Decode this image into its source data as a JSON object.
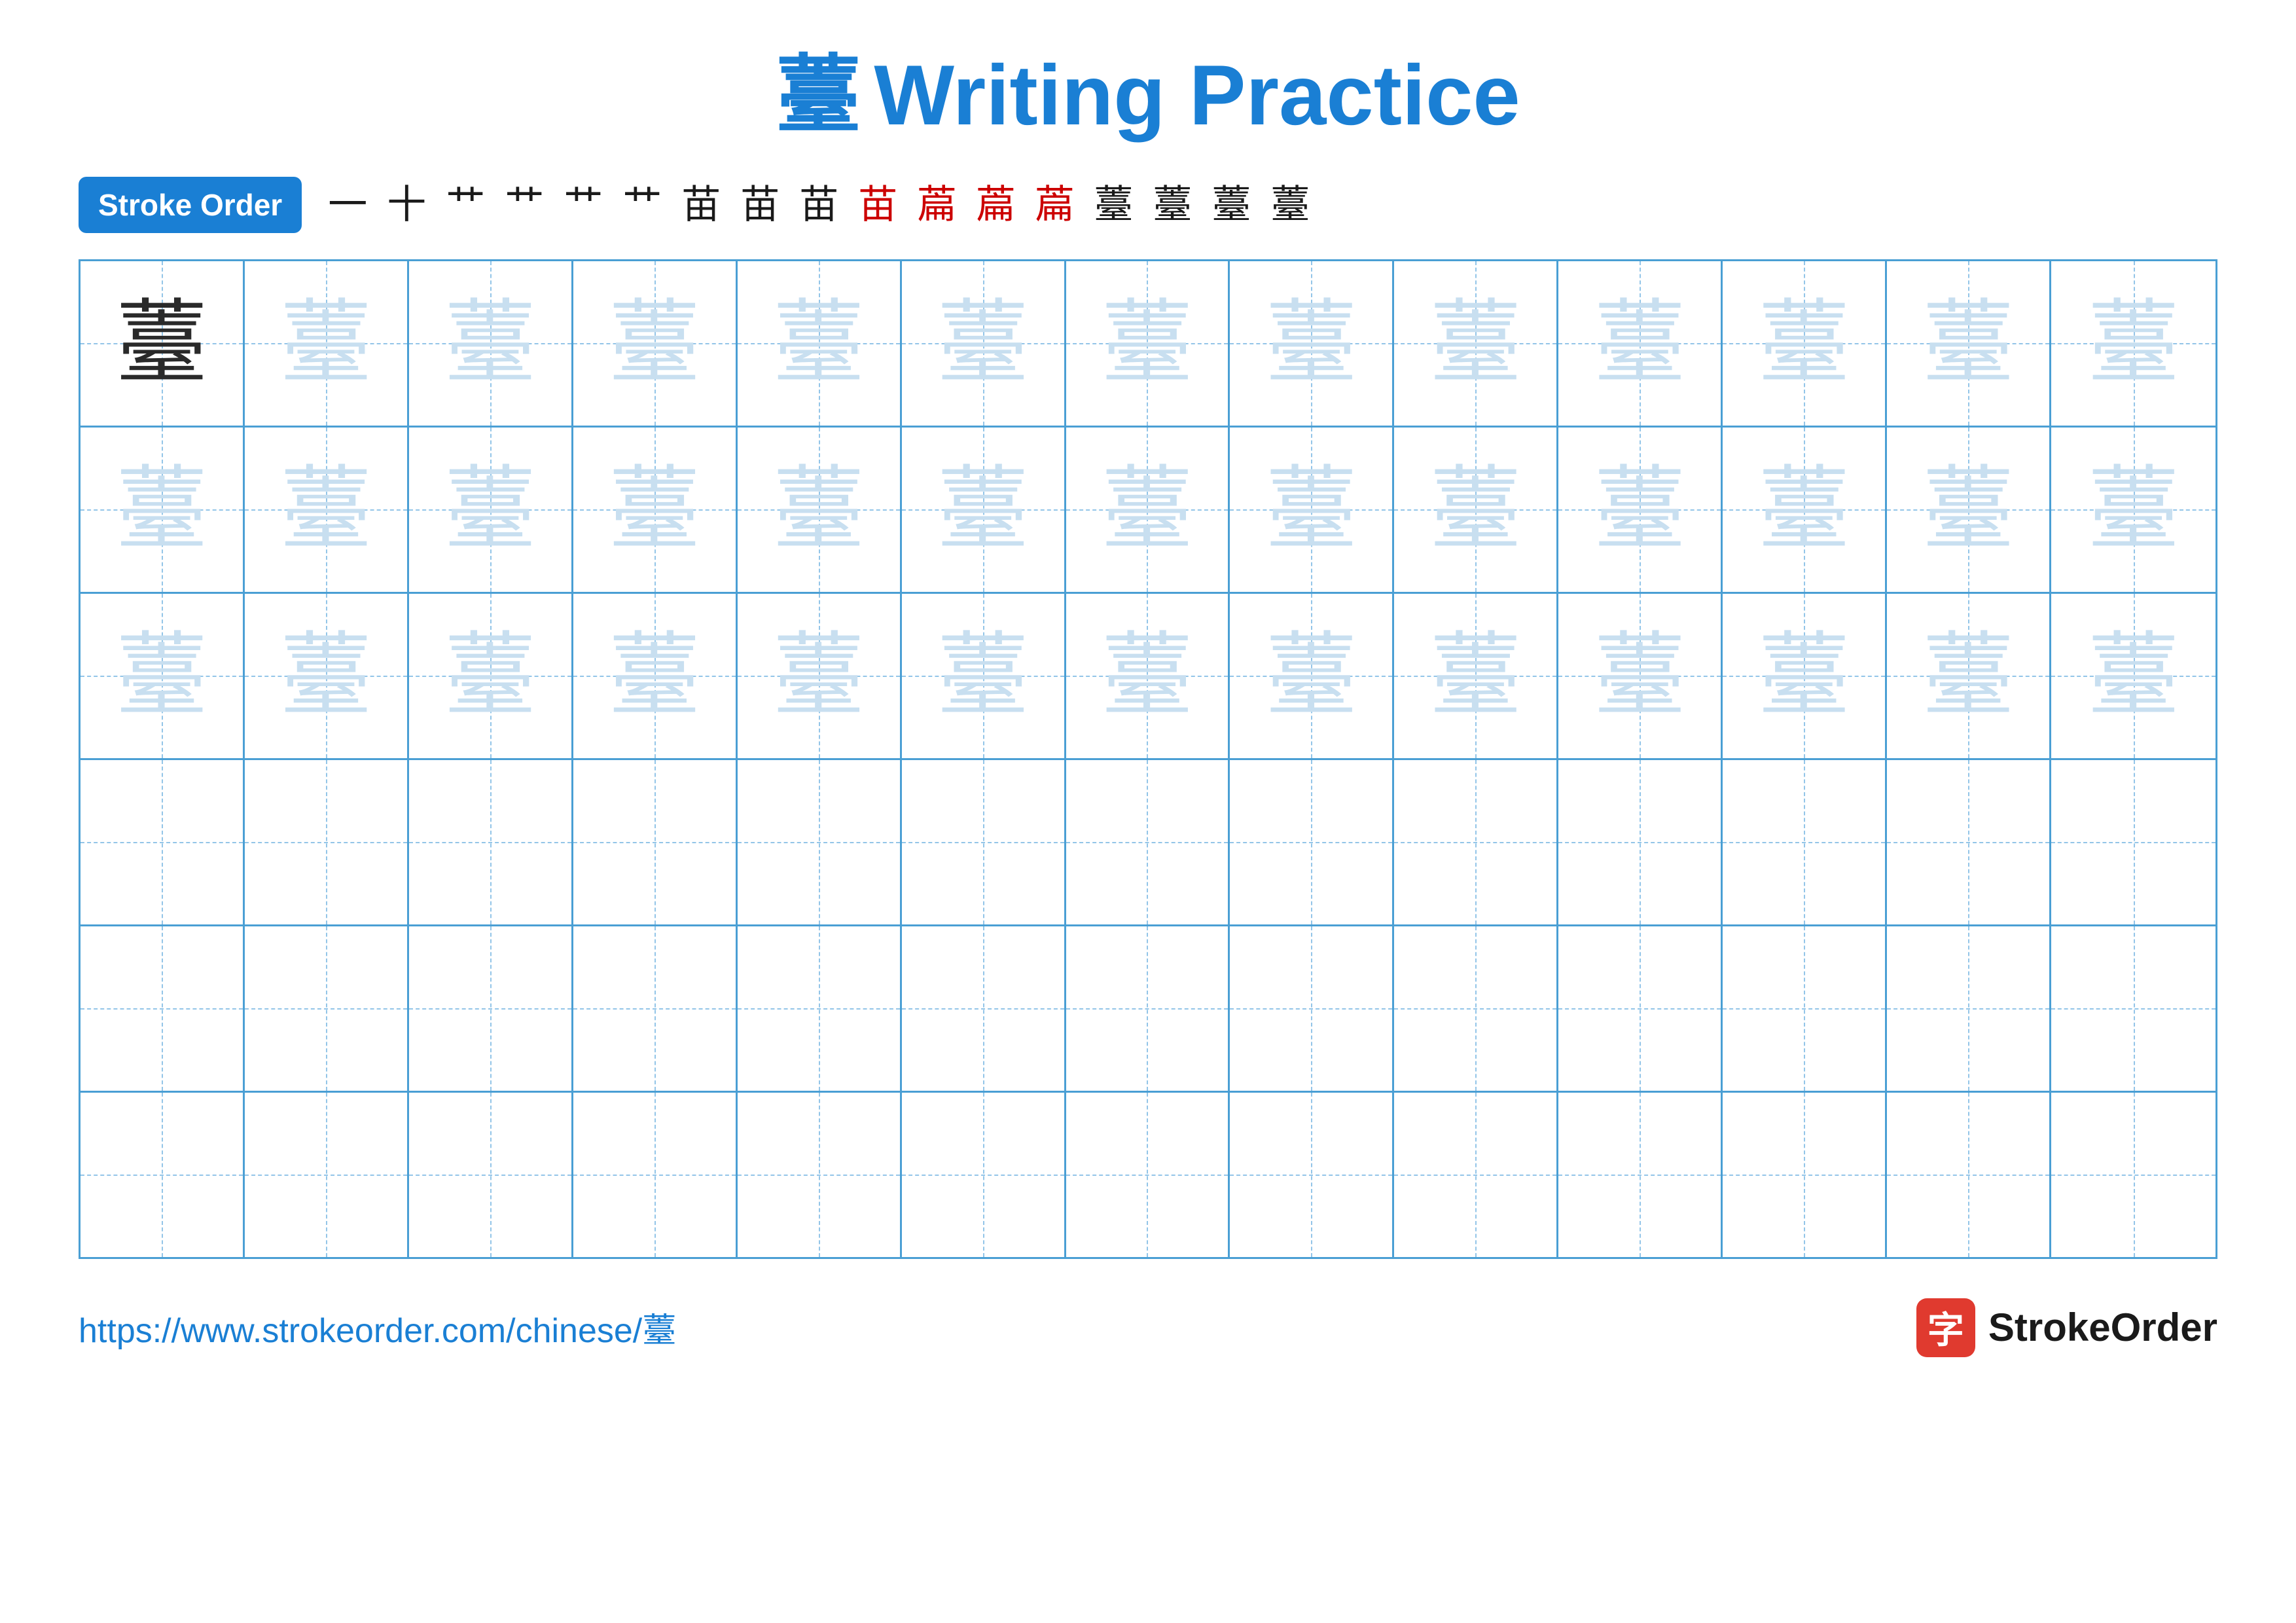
{
  "title": {
    "char": "薹",
    "text": "Writing Practice"
  },
  "stroke_order": {
    "badge_label": "Stroke Order",
    "steps": [
      "一",
      "十",
      "艹",
      "艹",
      "艹",
      "艹",
      "苗",
      "苗",
      "苗",
      "苗",
      "萹",
      "萹",
      "萹",
      "萹",
      "薹",
      "薹",
      "薹"
    ]
  },
  "practice": {
    "character": "薹",
    "rows": [
      {
        "type": "dark_then_light",
        "dark_count": 1,
        "light_count": 12
      },
      {
        "type": "light_only",
        "count": 13
      },
      {
        "type": "light_only",
        "count": 13
      },
      {
        "type": "empty",
        "count": 13
      },
      {
        "type": "empty",
        "count": 13
      },
      {
        "type": "empty",
        "count": 13
      }
    ]
  },
  "footer": {
    "url": "https://www.strokeorder.com/chinese/薹",
    "logo_char": "字",
    "logo_text": "StrokeOrder"
  }
}
